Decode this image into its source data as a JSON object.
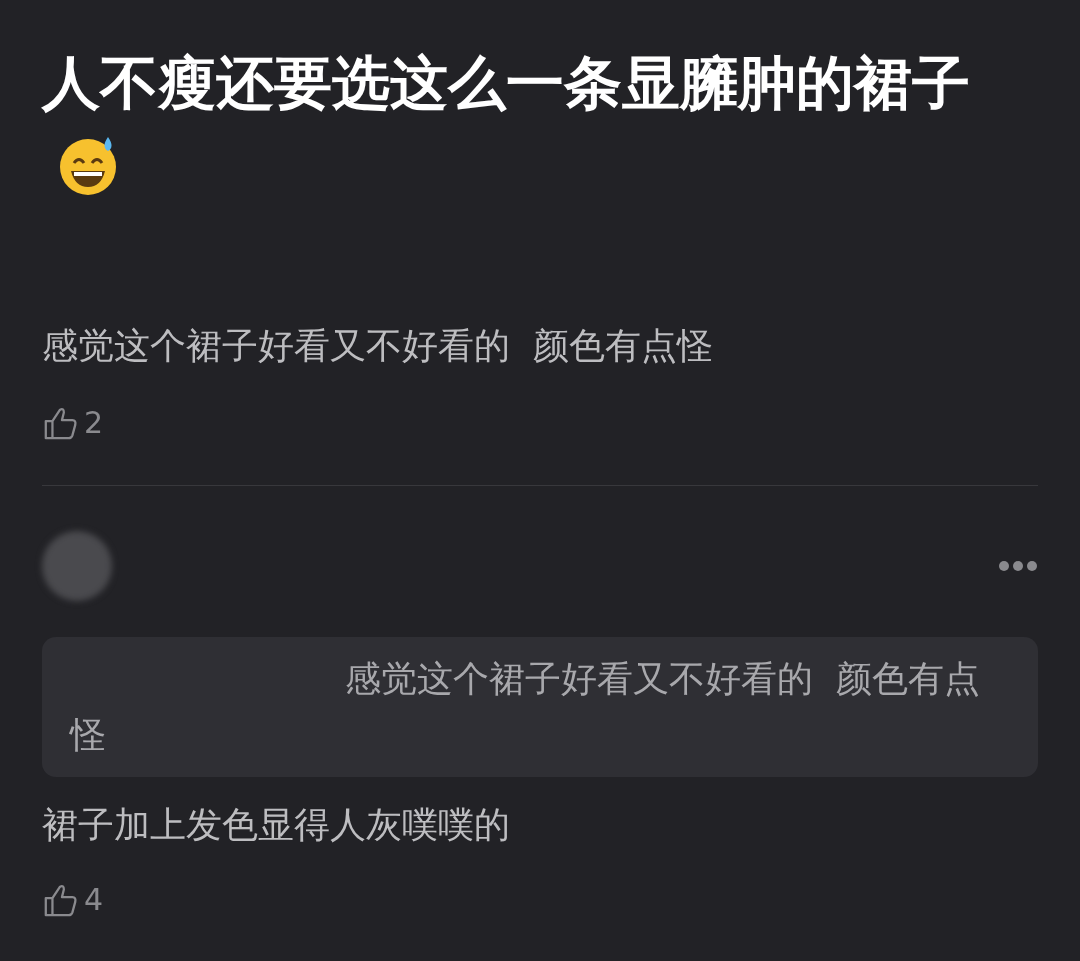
{
  "post": {
    "title": "人不瘦还要选这么一条显臃肿的裙子"
  },
  "comments": [
    {
      "text": "感觉这个裙子好看又不好看的  颜色有点怪",
      "likes": "2"
    },
    {
      "quote": "感觉这个裙子好看又不好看的  颜色有点怪",
      "text": "裙子加上发色显得人灰噗噗的",
      "likes": "4"
    }
  ]
}
